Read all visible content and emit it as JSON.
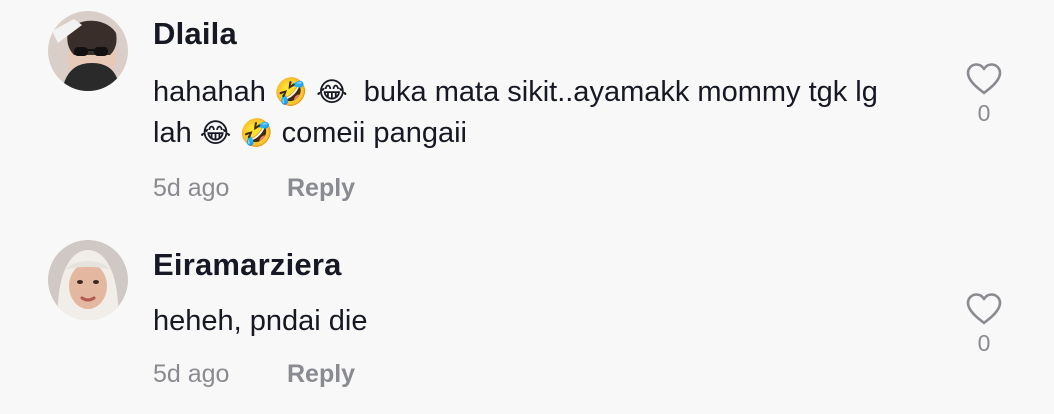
{
  "comments": [
    {
      "username": "Dlaila",
      "text_line1_a": "hahahah",
      "text_line1_emoji": "🤣 😂",
      "text_line1_b": "buka mata sikit..ayamakk mommy tgk lg",
      "text_line2_a": "lah",
      "text_line2_emoji": "😂 🤣",
      "text_line2_b": "comeii pangaii",
      "time": "5d ago",
      "reply_label": "Reply",
      "like_count": "0",
      "like_icon": "heart-outline-icon"
    },
    {
      "username": "Eiramarziera",
      "text": "heheh, pndai die",
      "time": "5d ago",
      "reply_label": "Reply",
      "like_count": "0",
      "like_icon": "heart-outline-icon"
    }
  ],
  "colors": {
    "background": "#f8f8f8",
    "primary_text": "#161823",
    "secondary_text": "#8a8b91"
  }
}
